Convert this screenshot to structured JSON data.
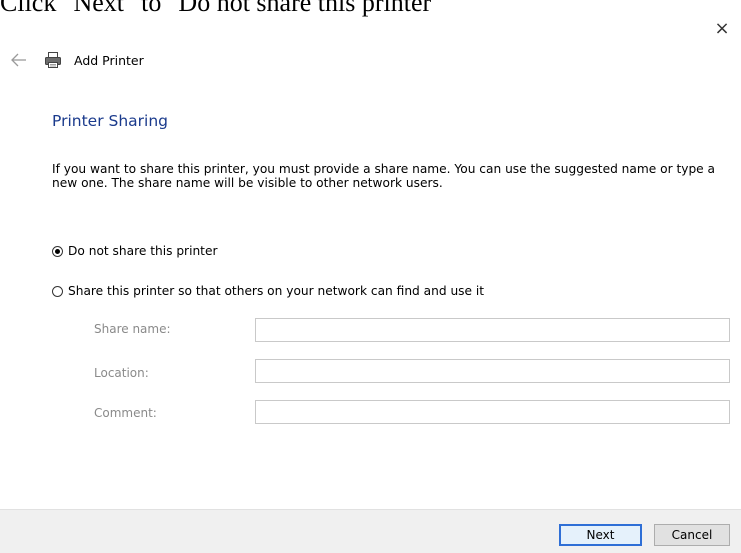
{
  "instruction": "Click \"Next\" to \"Do not share this printer\"",
  "window": {
    "title": "Add Printer",
    "close_glyph": "×",
    "icons": {
      "back": "back-arrow-icon",
      "printer": "printer-icon",
      "close": "close-icon"
    }
  },
  "page": {
    "heading": "Printer Sharing",
    "description": "If you want to share this printer, you must provide a share name. You can use the suggested name or type a new one. The share name will be visible to other network users."
  },
  "options": [
    {
      "label": "Do not share this printer",
      "selected": true
    },
    {
      "label": "Share this printer so that others on your network can find and use it",
      "selected": false
    }
  ],
  "fields": {
    "share_name": {
      "label": "Share name:",
      "value": ""
    },
    "location": {
      "label": "Location:",
      "value": ""
    },
    "comment": {
      "label": "Comment:",
      "value": ""
    }
  },
  "buttons": {
    "next": "Next",
    "cancel": "Cancel"
  },
  "colors": {
    "heading": "#1a3a8c",
    "footer_bg": "#f0f0f0",
    "default_button_border": "#2f6fd6"
  }
}
